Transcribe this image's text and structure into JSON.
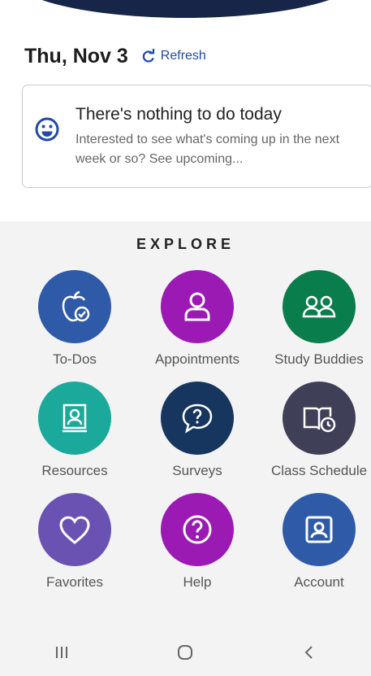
{
  "header": {
    "date": "Thu, Nov 3",
    "refresh_label": "Refresh"
  },
  "status_card": {
    "title": "There's nothing to do today",
    "text": "Interested to see what's coming up in the next week or so? See upcoming...",
    "icon": "smile-icon"
  },
  "explore": {
    "title": "EXPLORE",
    "tiles": [
      {
        "label": "To-Dos",
        "icon": "apple-check-icon",
        "color": "#2e5aa8"
      },
      {
        "label": "Appointments",
        "icon": "person-icon",
        "color": "#9b1ab4"
      },
      {
        "label": "Study Buddies",
        "icon": "study-buddies-icon",
        "color": "#0a7d4d"
      },
      {
        "label": "Resources",
        "icon": "book-person-icon",
        "color": "#1aa99a"
      },
      {
        "label": "Surveys",
        "icon": "speech-question-icon",
        "color": "#16355f"
      },
      {
        "label": "Class Schedule",
        "icon": "book-clock-icon",
        "color": "#3f4058"
      },
      {
        "label": "Favorites",
        "icon": "heart-icon",
        "color": "#6a52b3"
      },
      {
        "label": "Help",
        "icon": "question-icon",
        "color": "#9b1ab4"
      },
      {
        "label": "Account",
        "icon": "account-icon",
        "color": "#2e5aa8"
      }
    ]
  },
  "navbar": {
    "items": [
      "recent-apps-icon",
      "home-icon",
      "back-icon"
    ]
  },
  "colors": {
    "accent": "#1f4aa8",
    "header": "#172549"
  }
}
